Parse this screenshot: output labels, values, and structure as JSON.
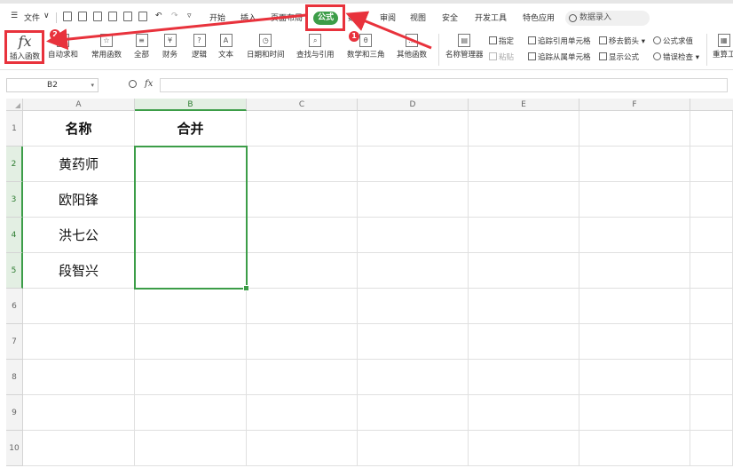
{
  "menu": {
    "file": "文件",
    "tabs": [
      "开始",
      "插入",
      "页面布局",
      "公式",
      "数据",
      "审阅",
      "视图",
      "安全",
      "开发工具",
      "特色应用"
    ],
    "active_tab": "公式",
    "search_placeholder": "数据录入"
  },
  "ribbon": {
    "insert_function": "插入函数",
    "buttons": [
      "自动求和",
      "常用函数",
      "全部",
      "财务",
      "逻辑",
      "文本",
      "日期和时间",
      "查找与引用",
      "数学和三角",
      "其他函数"
    ],
    "name_manager": "名称管理器",
    "specify": "指定",
    "paste": "粘贴",
    "trace_precedents": "追踪引用单元格",
    "trace_dependents": "追踪从属单元格",
    "remove_arrows": "移去箭头",
    "show_formulas": "显示公式",
    "evaluate_formula": "公式求值",
    "error_check": "错误检查",
    "recalc": "重算工"
  },
  "formula_bar": {
    "name_box": "B2",
    "fx_label": "fx",
    "value": ""
  },
  "sheet": {
    "columns": [
      "A",
      "B",
      "C",
      "D",
      "E",
      "F"
    ],
    "rows": [
      "1",
      "2",
      "3",
      "4",
      "5",
      "6",
      "7",
      "8",
      "9",
      "10"
    ],
    "selected_column": "B",
    "cells": {
      "A1": "名称",
      "B1": "合并",
      "A2": "黄药师",
      "A3": "欧阳锋",
      "A4": "洪七公",
      "A5": "段智兴"
    }
  },
  "annotations": {
    "step1": "1",
    "step2": "2",
    "color": "#e8323c"
  },
  "colors": {
    "accent": "#3c9d48",
    "annotation": "#e8323c"
  }
}
